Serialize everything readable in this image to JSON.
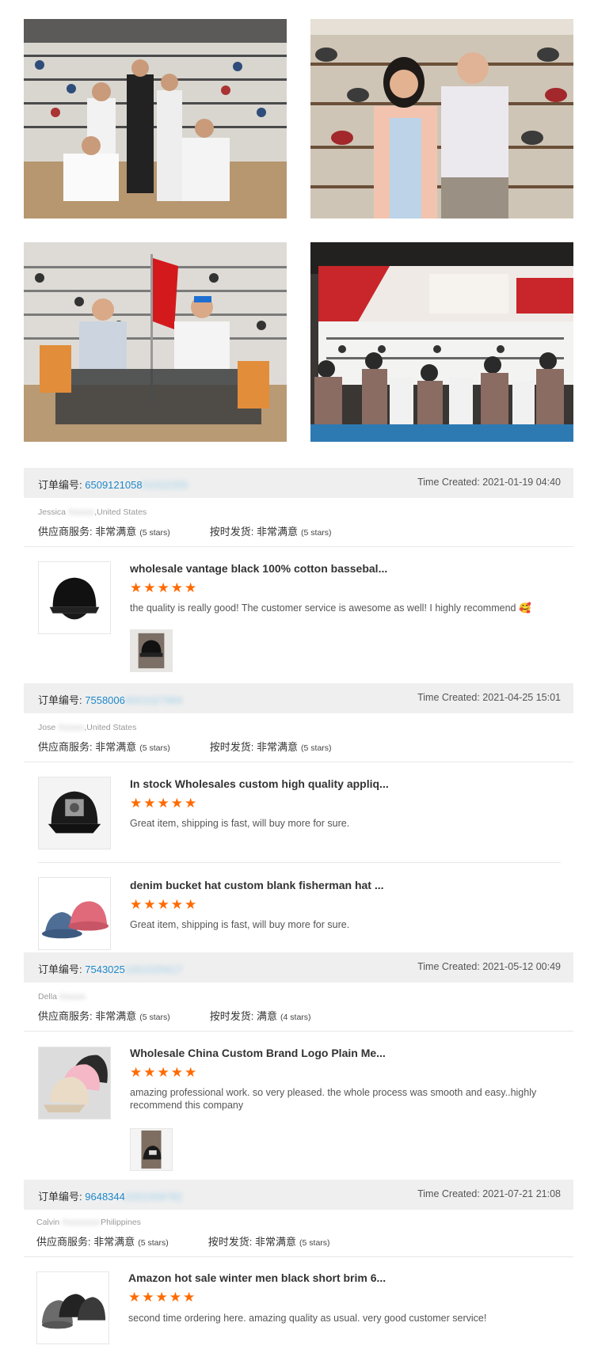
{
  "orders": [
    {
      "order_label": "订单编号:",
      "order_num_visible": "6509121058",
      "order_num_blurred": "01022255",
      "time_created": "Time Created: 2021-01-19 04:40",
      "buyer_name": "Jessica",
      "buyer_blurred": "Xxxxxx",
      "buyer_country": ",United States",
      "supplier_service": "供应商服务:",
      "supplier_rating": "非常满意",
      "supplier_stars": "(5 stars)",
      "ontime": "按时发货:",
      "ontime_rating": "非常满意",
      "ontime_stars": "(5 stars)",
      "items": [
        {
          "title": "wholesale vantage black 100% cotton bassebal...",
          "stars": "★★★★★",
          "review": "the quality is really good! The customer service is awesome as well! I highly recommend 🥰"
        }
      ]
    },
    {
      "order_label": "订单编号:",
      "order_num_visible": "7558006",
      "order_num_blurred": "6001027984",
      "time_created": "Time Created: 2021-04-25 15:01",
      "buyer_name": "Jose",
      "buyer_blurred": "Xxxxxx",
      "buyer_country": ",United States",
      "supplier_service": "供应商服务:",
      "supplier_rating": "非常满意",
      "supplier_stars": "(5 stars)",
      "ontime": "按时发货:",
      "ontime_rating": "非常满意",
      "ontime_stars": "(5 stars)",
      "items": [
        {
          "title": "In stock Wholesales custom high quality appliq...",
          "stars": "★★★★★",
          "review": "Great item, shipping is fast, will buy more for sure."
        },
        {
          "title": "denim bucket hat custom blank fisherman hat ...",
          "stars": "★★★★★",
          "review": "Great item, shipping is fast, will buy more for sure."
        }
      ]
    },
    {
      "order_label": "订单编号:",
      "order_num_visible": "7543025",
      "order_num_blurred": "1001025617",
      "time_created": "Time Created: 2021-05-12 00:49",
      "buyer_name": "Della",
      "buyer_blurred": "Xxxxxx",
      "buyer_country": "",
      "supplier_service": "供应商服务:",
      "supplier_rating": "非常满意",
      "supplier_stars": "(5 stars)",
      "ontime": "按时发货:",
      "ontime_rating": "满意",
      "ontime_stars": "(4 stars)",
      "items": [
        {
          "title": "Wholesale China Custom Brand Logo Plain Me...",
          "stars": "★★★★★",
          "review": "amazing professional work. so very pleased.  the whole process was smooth and easy..highly recommend this company"
        }
      ]
    },
    {
      "order_label": "订单编号:",
      "order_num_visible": "9648344",
      "order_num_blurred": "2001059782",
      "time_created": "Time Created: 2021-07-21 21:08",
      "buyer_name": "Calvin",
      "buyer_blurred": "Xxxxxxxxx",
      "buyer_country": "Philippines",
      "supplier_service": "供应商服务:",
      "supplier_rating": "非常满意",
      "supplier_stars": "(5 stars)",
      "ontime": "按时发货:",
      "ontime_rating": "非常满意",
      "ontime_stars": "(5 stars)",
      "items": [
        {
          "title": "Amazon hot sale winter men black short brim 6...",
          "stars": "★★★★★",
          "review": "second time ordering here. amazing quality as usual. very good customer service!"
        }
      ]
    }
  ],
  "colors": {
    "accent": "#1e88c9",
    "star": "#ff6a00",
    "bar": "#efefef"
  }
}
